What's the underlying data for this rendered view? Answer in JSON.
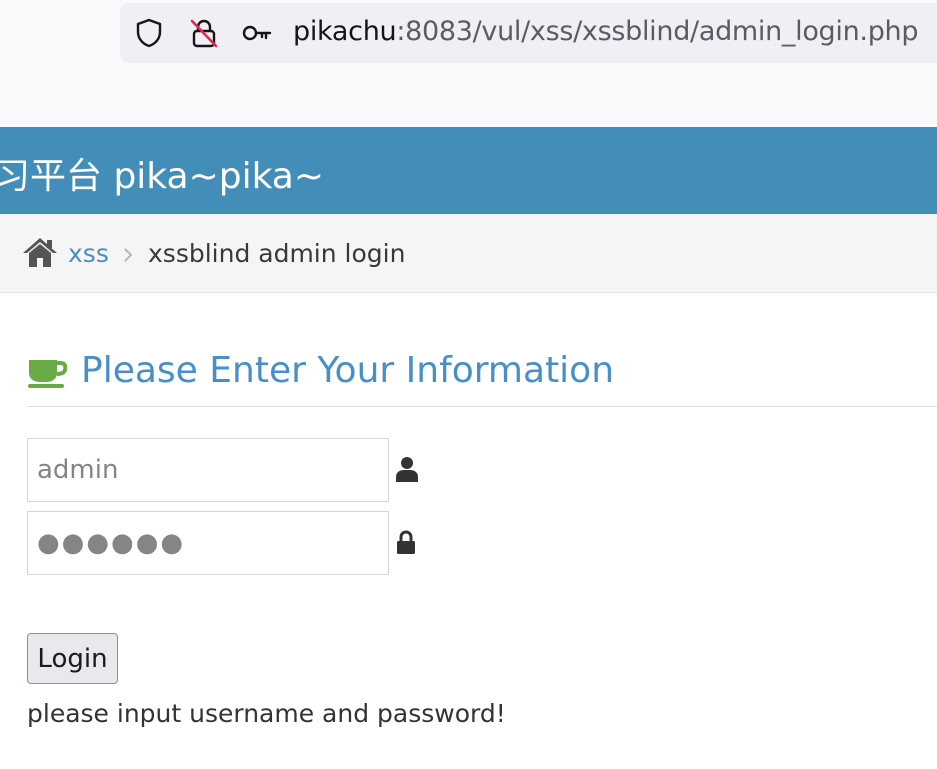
{
  "browser": {
    "url_host": "pikachu",
    "url_rest": ":8083/vul/xss/xssblind/admin_login.php",
    "icons": [
      "shield-icon",
      "lock-crossed-icon",
      "key-icon"
    ]
  },
  "site": {
    "title": "习平台 pika~pika~",
    "header_color": "#438eb9"
  },
  "breadcrumb": {
    "icon": "home-icon",
    "link": "xss",
    "current": "xssblind admin login"
  },
  "form": {
    "icon": "coffee-cup-icon",
    "title": "Please Enter Your Information",
    "username_value": "admin",
    "password_value": "●●●●●●",
    "username_icon": "user-icon",
    "password_icon": "lock-icon",
    "login_label": "Login",
    "message": "please input username and password!",
    "accent_color": "#478fca",
    "cup_color": "#69aa46"
  }
}
